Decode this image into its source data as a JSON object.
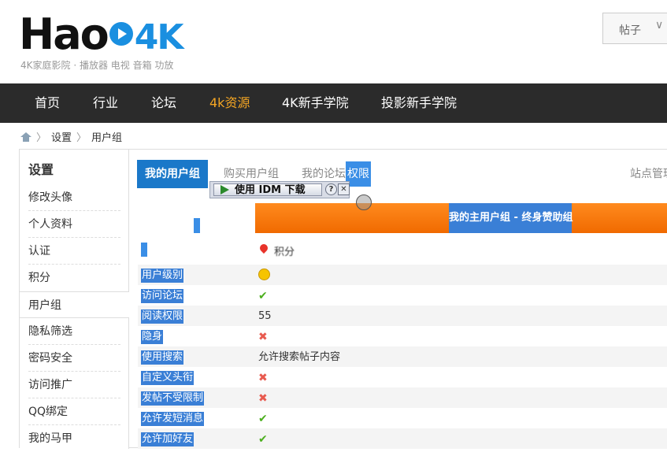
{
  "header": {
    "logo_text": "Hao",
    "logo_4k": "4K",
    "logo_tagline": "4K家庭影院 · 播放器 电视 音箱 功放",
    "search_type": "帖子",
    "search_chevron": "∨"
  },
  "nav": {
    "items": [
      "首页",
      "行业",
      "论坛",
      "4k资源",
      "4K新手学院",
      "投影新手学院"
    ],
    "active": "4k资源"
  },
  "breadcrumb": [
    "设置",
    "用户组"
  ],
  "sidebar": {
    "title": "设置",
    "items": [
      "修改头像",
      "个人资料",
      "认证",
      "积分",
      "用户组",
      "隐私筛选",
      "密码安全",
      "访问推广",
      "QQ绑定",
      "我的马甲"
    ],
    "current": "用户组"
  },
  "tabs": {
    "my_groups": "我的用户组",
    "buy_groups": "购买用户组",
    "forum_perm_prefix": "我的论坛",
    "forum_perm_suffix": "权限",
    "site_admin": "站点管理"
  },
  "idm": {
    "button_label": "使用 IDM 下载",
    "help": "?",
    "close": "✕"
  },
  "banner": {
    "main_group": "我的主用户组 - 终身赞助组"
  },
  "user": {
    "name": "积分"
  },
  "rows": [
    {
      "label": "用户级别",
      "value": "",
      "kind": "smile"
    },
    {
      "label": "访问论坛",
      "value": "✔",
      "kind": "check"
    },
    {
      "label": "阅读权限",
      "value": "55",
      "kind": "text"
    },
    {
      "label": "隐身",
      "value": "✖",
      "kind": "cross"
    },
    {
      "label": "使用搜索",
      "value": "允许搜索帖子内容",
      "kind": "text"
    },
    {
      "label": "自定义头衔",
      "value": "✖",
      "kind": "cross"
    },
    {
      "label": "发帖不受限制",
      "value": "✖",
      "kind": "cross"
    },
    {
      "label": "允许发短消息",
      "value": "✔",
      "kind": "check"
    },
    {
      "label": "允许加好友",
      "value": "✔",
      "kind": "check"
    }
  ],
  "colors": {
    "nav_bg": "#2b2b2b",
    "nav_active": "#f5a623",
    "tab_active": "#1a78c9",
    "banner_orange": "#f07a10",
    "check": "#4caf1e",
    "cross": "#e85a4f"
  }
}
